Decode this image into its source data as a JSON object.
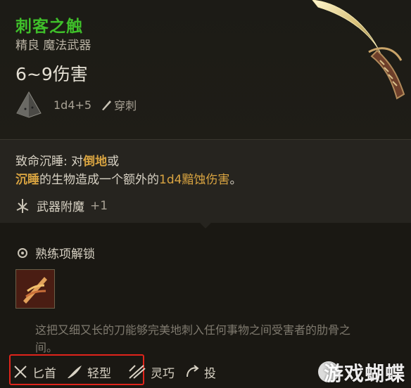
{
  "item": {
    "name": "刺客之触",
    "subtitle": "精良 魔法武器",
    "damage": "6~9伤害",
    "dice": "1d4+5",
    "damage_type": "穿刺"
  },
  "passive": {
    "prefix": "致命沉睡: 对",
    "kw1": "倒地",
    "mid1": "或",
    "kw2": "沉睡",
    "mid2": "的生物造成一个额外的",
    "kw3": "1d4黯蚀伤害",
    "suffix": "。"
  },
  "enchant": {
    "label": "武器附魔",
    "value": "+1"
  },
  "proficiency": {
    "label": "熟练项解锁"
  },
  "description": "这把又细又长的刀能够完美地刺入任何事物之间受害者的肋骨之间。",
  "tags": [
    {
      "label": "匕首",
      "icon": "dagger-icon"
    },
    {
      "label": "轻型",
      "icon": "feather-icon"
    },
    {
      "label": "灵巧",
      "icon": "finesse-icon"
    },
    {
      "label": "投",
      "icon": "throw-icon"
    }
  ],
  "watermark": "游戏蝴蝶",
  "colors": {
    "name_green": "#3fbf2a",
    "keyword_gold": "#d9a441",
    "highlight_red": "#e0241b"
  }
}
